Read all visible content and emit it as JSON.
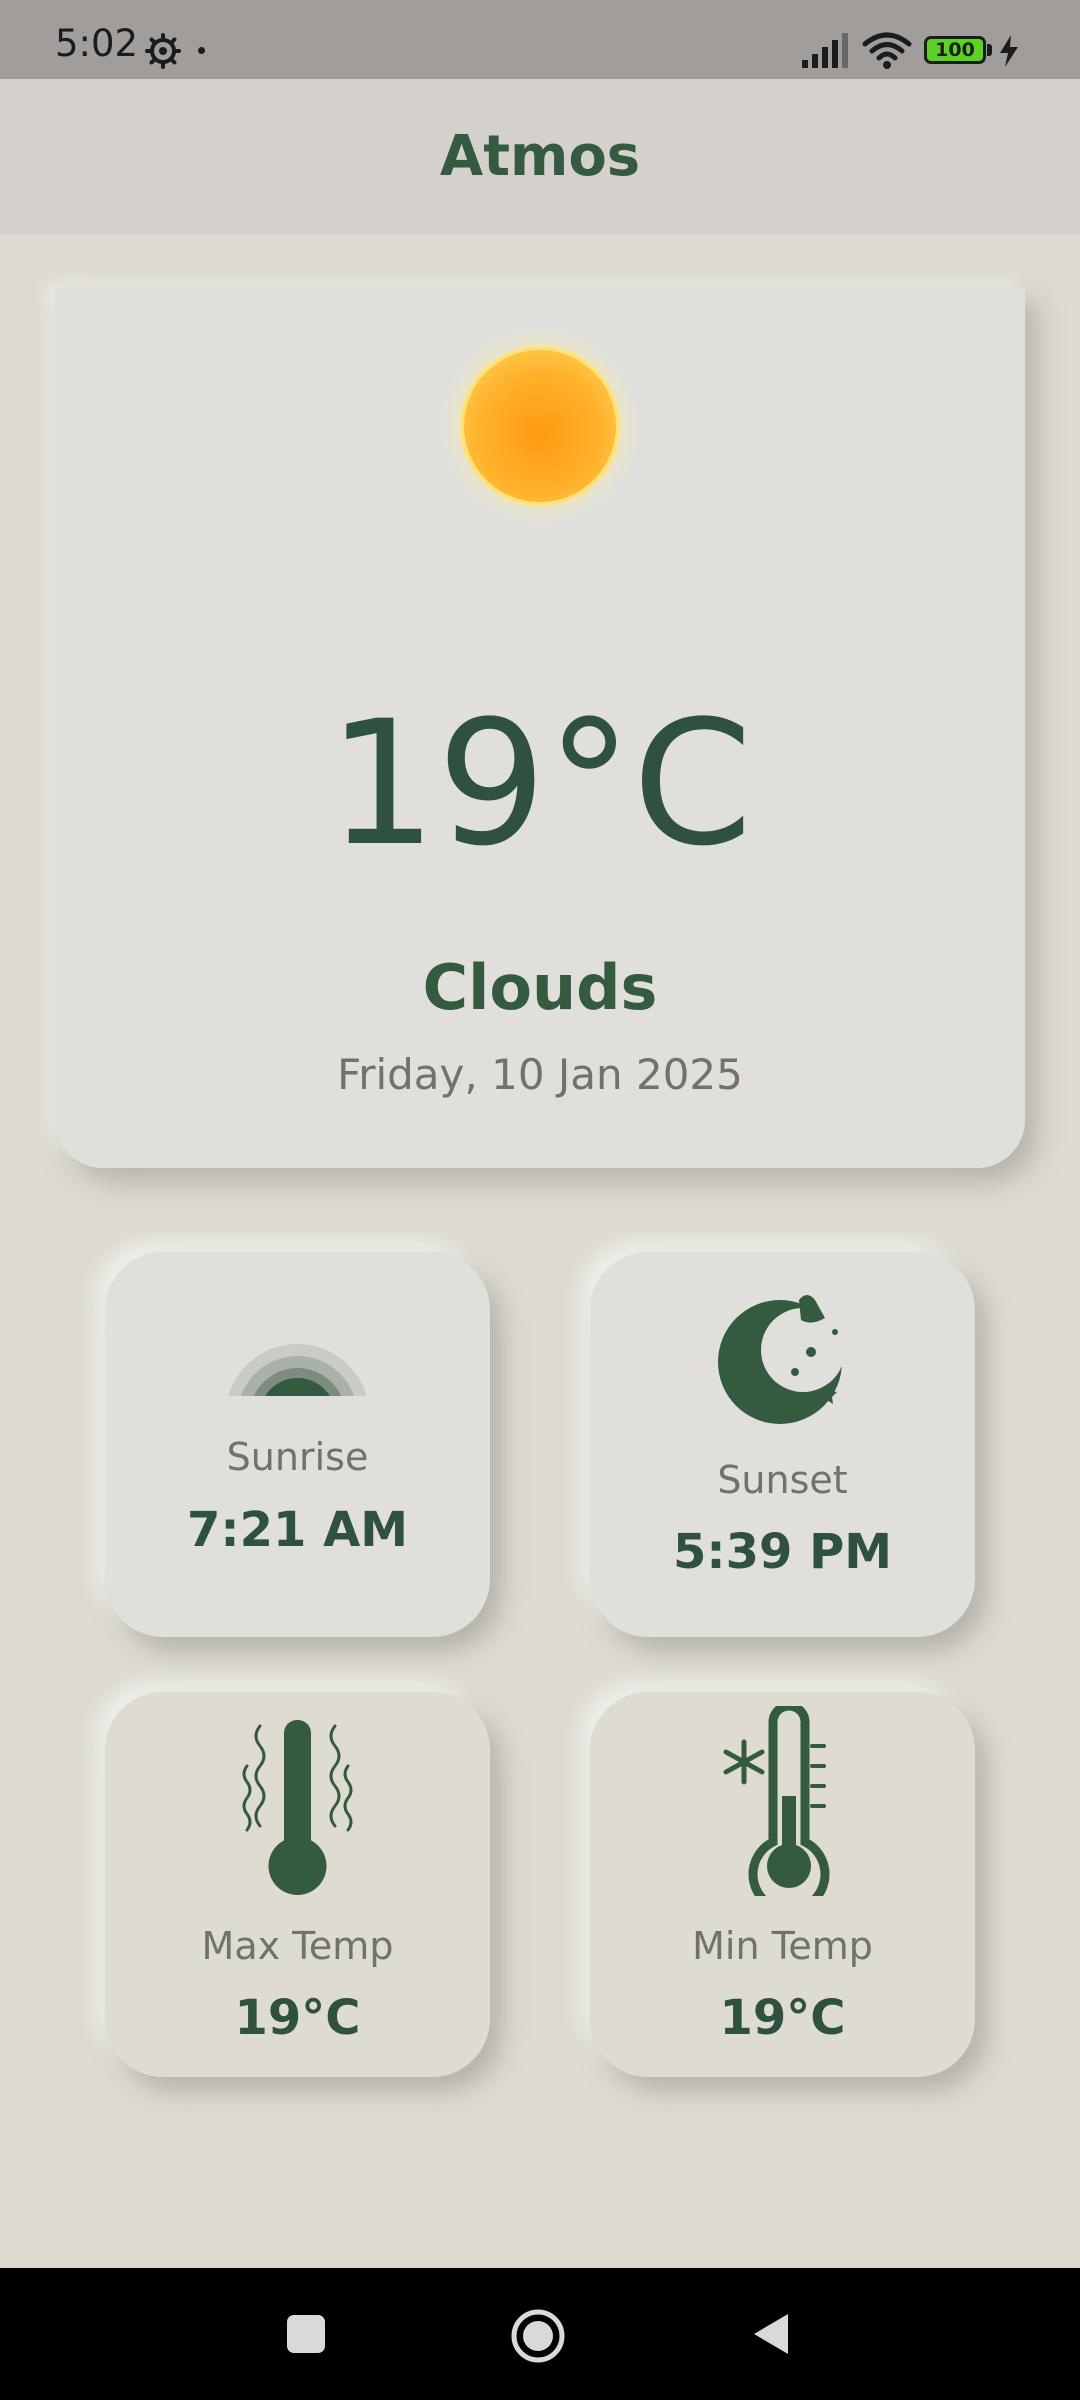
{
  "status_bar": {
    "time": "5:02",
    "battery": "100"
  },
  "app": {
    "title": "Atmos"
  },
  "weather": {
    "temperature": "19°C",
    "condition": "Clouds",
    "date": "Friday, 10 Jan 2025"
  },
  "tiles": {
    "sunrise": {
      "label": "Sunrise",
      "value": "7:21 AM"
    },
    "sunset": {
      "label": "Sunset",
      "value": "5:39 PM"
    },
    "max_temp": {
      "label": "Max Temp",
      "value": "19°C"
    },
    "min_temp": {
      "label": "Min Temp",
      "value": "19°C"
    }
  },
  "colors": {
    "accent_green": "#345a40",
    "background": "#dddbd0",
    "sun_orange": "#ff9f1c"
  },
  "icons": {
    "status": [
      "gear-icon",
      "signal-icon",
      "wifi-icon",
      "battery-icon",
      "charging-icon"
    ],
    "weather": "sun-icon",
    "tiles": [
      "sunrise-icon",
      "sunset-moon-icon",
      "max-temp-thermometer-icon",
      "min-temp-thermometer-icon"
    ],
    "nav": [
      "recents-icon",
      "home-icon",
      "back-icon"
    ]
  }
}
